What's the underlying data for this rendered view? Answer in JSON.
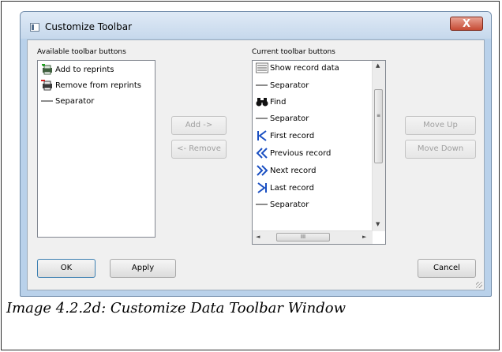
{
  "dialog": {
    "title": "Customize Toolbar",
    "close_label": "X"
  },
  "available": {
    "label": "Available toolbar buttons",
    "items": [
      {
        "label": "Add to reprints",
        "icon": "printer-add-icon"
      },
      {
        "label": "Remove from reprints",
        "icon": "printer-remove-icon"
      },
      {
        "label": "Separator",
        "icon": "separator-icon"
      }
    ]
  },
  "current": {
    "label": "Current toolbar buttons",
    "items": [
      {
        "label": "Show record data",
        "icon": "record-data-icon"
      },
      {
        "label": "Separator",
        "icon": "separator-icon"
      },
      {
        "label": "Find",
        "icon": "binoculars-icon"
      },
      {
        "label": "Separator",
        "icon": "separator-icon"
      },
      {
        "label": "First record",
        "icon": "first-record-icon"
      },
      {
        "label": "Previous record",
        "icon": "previous-record-icon"
      },
      {
        "label": "Next record",
        "icon": "next-record-icon"
      },
      {
        "label": "Last record",
        "icon": "last-record-icon"
      },
      {
        "label": "Separator",
        "icon": "separator-icon"
      }
    ],
    "scroll_glyph": "III"
  },
  "buttons": {
    "add": "Add ->",
    "remove": "<- Remove",
    "move_up": "Move Up",
    "move_down": "Move Down",
    "ok": "OK",
    "apply": "Apply",
    "cancel": "Cancel"
  },
  "caption": "Image 4.2.2d: Customize Data Toolbar Window",
  "colors": {
    "accent_blue": "#1a4fc2",
    "close_red": "#c74b34"
  }
}
